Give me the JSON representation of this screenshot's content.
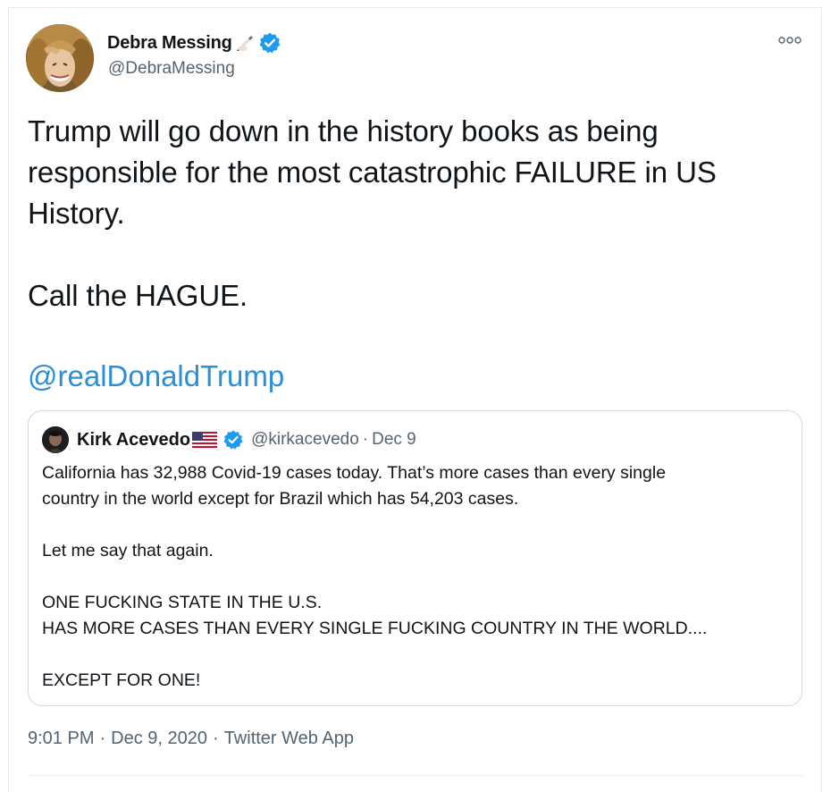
{
  "tweet": {
    "author": {
      "display_name": "Debra Messing",
      "name_emoji": "writing-hand-emoji",
      "handle": "@DebraMessing",
      "verified": true,
      "avatar": "avatar-photo"
    },
    "text": "Trump will go down in the history books as being\nresponsible for the most catastrophic FAILURE in US\nHistory.\n\nCall the HAGUE.",
    "mention": "@realDonaldTrump",
    "more_icon": "more-options-icon",
    "quoted": {
      "display_name": "Kirk Acevedo",
      "name_emoji": "us-flag-emoji",
      "handle": "@kirkacevedo",
      "dot": "·",
      "date": "Dec 9",
      "verified": true,
      "text": "California has 32,988 Covid-19 cases today. That’s more cases than every single\ncountry in the world except for Brazil which has 54,203 cases.\n\nLet me say that again.\n\nONE FUCKING STATE IN THE U.S.\nHAS MORE CASES THAN EVERY SINGLE FUCKING COUNTRY IN THE WORLD....\n\nEXCEPT FOR ONE!"
    },
    "meta": {
      "time": "9:01 PM",
      "dot": "·",
      "date": "Dec 9, 2020",
      "source": "Twitter Web App"
    }
  },
  "colors": {
    "link": "#2b8fd6",
    "verified": "#1d9bf0",
    "secondary_text": "#536471",
    "border": "#cfd9de"
  }
}
